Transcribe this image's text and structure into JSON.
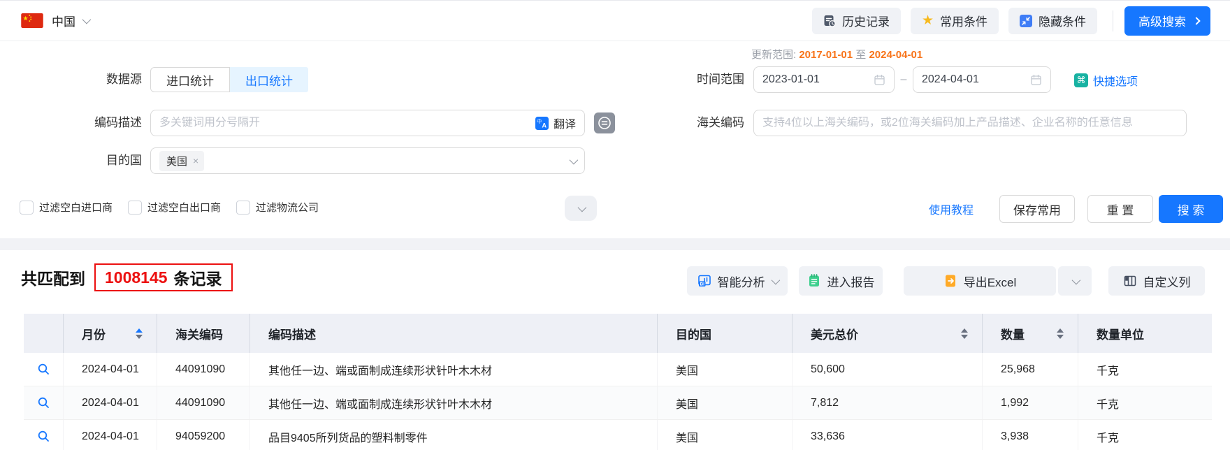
{
  "colors": {
    "accent": "#1677ff",
    "tabbg": "#e6f4ff",
    "orange": "#f8741a",
    "red": "#ec1010",
    "btnbg": "#f0f2f6",
    "headerbg": "#eef0f6",
    "star": "#f7ba1e",
    "teal": "#18b2a2",
    "green": "#3ecf8e",
    "excel": "#ffaa27"
  },
  "topbar": {
    "country": "中国",
    "history_btn": "历史记录",
    "favorites_btn": "常用条件",
    "hide_btn": "隐藏条件",
    "advanced_search_btn": "高级搜索"
  },
  "filters": {
    "data_source": {
      "label": "数据源",
      "tabs": [
        "进口统计",
        "出口统计"
      ]
    },
    "update_range": {
      "label": "更新范围:",
      "from": "2017-01-01",
      "conj": "至",
      "to": "2024-04-01"
    },
    "time_range": {
      "label": "时间范围",
      "start": "2023-01-01",
      "separator": "–",
      "end": "2024-04-01",
      "quick_option": "快捷选项"
    },
    "code_desc": {
      "label": "编码描述",
      "placeholder": "多关键词用分号隔开",
      "translate": "翻译"
    },
    "hs_code": {
      "label": "海关编码",
      "placeholder": "支持4位以上海关编码，或2位海关编码加上产品描述、企业名称的任意信息"
    },
    "dest_country": {
      "label": "目的国",
      "tag": "美国",
      "tag_close": "×"
    },
    "checkboxes": [
      "过滤空白进口商",
      "过滤空白出口商",
      "过滤物流公司"
    ],
    "tutorial_link": "使用教程",
    "save_btn": "保存常用",
    "reset_btn": "重 置",
    "search_btn": "搜 索"
  },
  "results": {
    "prefix": "共匹配到",
    "count": "1008145",
    "suffix": "条记录",
    "analysis_btn": "智能分析",
    "report_btn": "进入报告",
    "export_btn": "导出Excel",
    "custom_cols_btn": "自定义列"
  },
  "table": {
    "headers": [
      "月份",
      "海关编码",
      "编码描述",
      "目的国",
      "美元总价",
      "数量",
      "数量单位"
    ],
    "rows": [
      {
        "month": "2024-04-01",
        "hs_code": "44091090",
        "desc": "其他任一边、端或面制成连续形状针叶木木材",
        "country": "美国",
        "usd": "50,600",
        "qty": "25,968",
        "unit": "千克"
      },
      {
        "month": "2024-04-01",
        "hs_code": "44091090",
        "desc": "其他任一边、端或面制成连续形状针叶木木材",
        "country": "美国",
        "usd": "7,812",
        "qty": "1,992",
        "unit": "千克"
      },
      {
        "month": "2024-04-01",
        "hs_code": "94059200",
        "desc": "品目9405所列货品的塑料制零件",
        "country": "美国",
        "usd": "33,636",
        "qty": "3,938",
        "unit": "千克"
      }
    ]
  }
}
